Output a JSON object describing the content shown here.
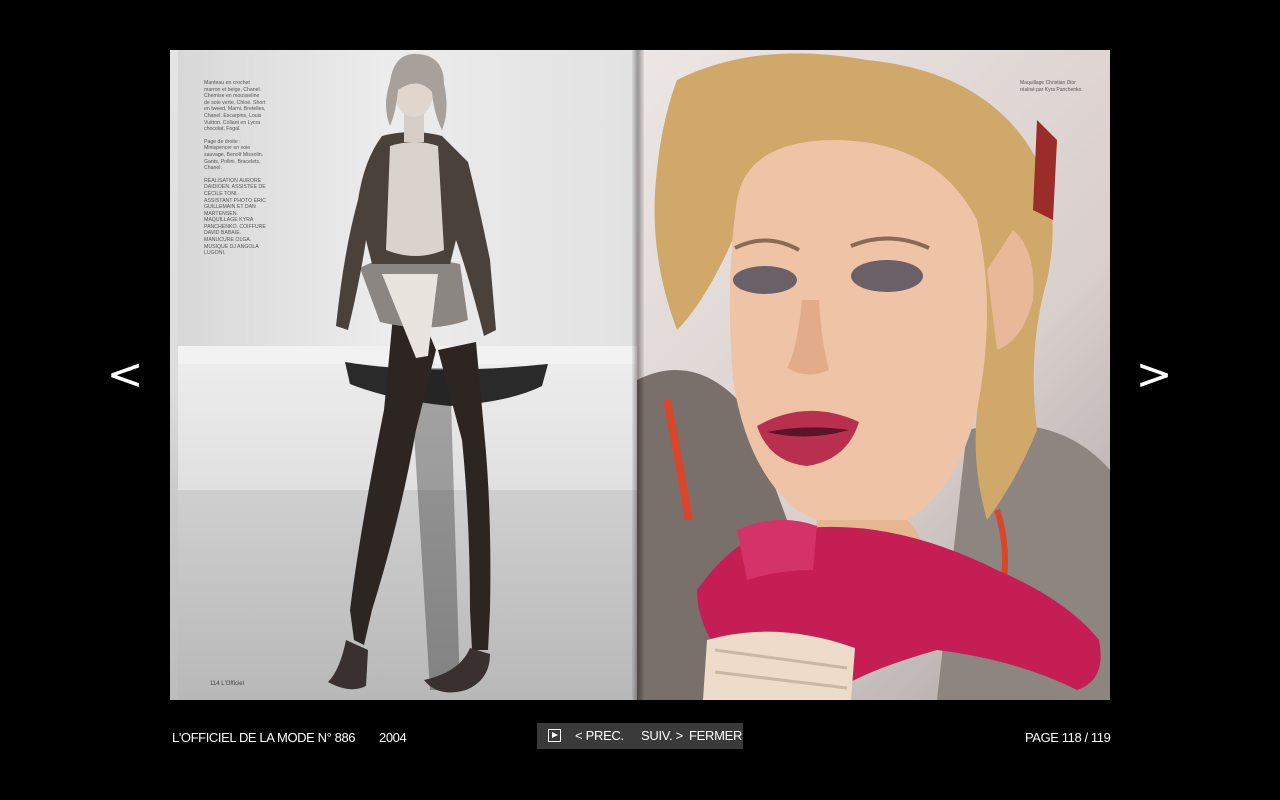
{
  "navigation": {
    "prev_arrow": "<",
    "next_arrow": ">"
  },
  "magazine": {
    "title": "L'OFFICIEL DE LA MODE N° 886",
    "year": "2004",
    "page_indicator": "PAGE 118 / 119"
  },
  "controls": {
    "play_icon": "play-icon",
    "prev_label": "< PREC.",
    "next_label": "SUIV. >",
    "close_label": "FERMER"
  },
  "left_page": {
    "credits_1": "Manteau en crochet marron et beige, Chanel. Chemise en mousseline de soie verte, Chloé. Short en tweed, Marni. Bretelles, Chanel. Escarpins, Louis Vuitton. Collant en Lycra chocolat, Fogal.",
    "credits_2": "Page de droite : Minispencer en soie sauvage, Benoît Missolin. Gants, Pollini. Bracelets, Chanel.",
    "credits_3": "RÉALISATION AURORE DAIDIOEN. ASSISTÉE DE CÉCILE TONI. ASSISTANT PHOTO ERIC GUILLEMAIN ET DAN MARTENSEN. MAQUILLAGE KYRA PANCHENKO. COIFFURE DAVID BABAIE. MANUCURE OLGA. MUSIQUE DJ ANGOLA LUGONI.",
    "folio": "114 L'Officiel"
  },
  "right_page": {
    "credit": "Maquillage Christian Dior réalisé par Kyra Panchenko."
  },
  "colors": {
    "background": "#000000",
    "control_bar": "#3a3a3a",
    "glove": "#c41e54",
    "lips": "#b8304e"
  }
}
